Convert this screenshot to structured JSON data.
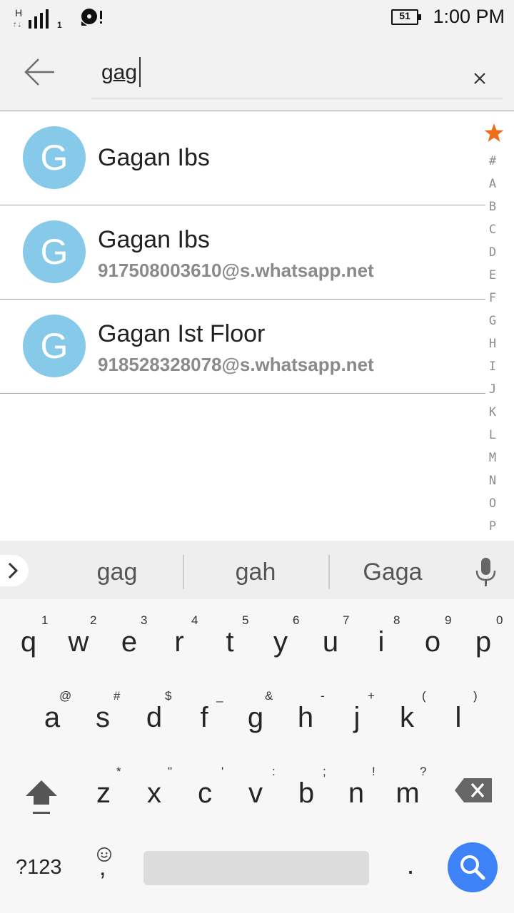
{
  "status_bar": {
    "network_type": "H",
    "sim_slot": "1",
    "battery_level": "51",
    "time": "1:00 PM"
  },
  "search": {
    "query": "gag",
    "back_icon": "arrow-left-icon",
    "clear_icon": "close-icon"
  },
  "contacts": [
    {
      "initial": "G",
      "name": "Gagan Ibs",
      "subtitle": ""
    },
    {
      "initial": "G",
      "name": "Gagan Ibs",
      "subtitle": "917508003610@s.whatsapp.net"
    },
    {
      "initial": "G",
      "name": "Gagan Ist Floor",
      "subtitle": "918528328078@s.whatsapp.net"
    }
  ],
  "index_bar": {
    "star_icon": "star-icon",
    "star_color": "#ef6c1a",
    "letters": [
      "#",
      "A",
      "B",
      "C",
      "D",
      "E",
      "F",
      "G",
      "H",
      "I",
      "J",
      "K",
      "L",
      "M",
      "N",
      "O",
      "P"
    ]
  },
  "keyboard": {
    "suggestions": [
      "gag",
      "gah",
      "Gaga"
    ],
    "row1": [
      {
        "key": "q",
        "alt": "1"
      },
      {
        "key": "w",
        "alt": "2"
      },
      {
        "key": "e",
        "alt": "3"
      },
      {
        "key": "r",
        "alt": "4"
      },
      {
        "key": "t",
        "alt": "5"
      },
      {
        "key": "y",
        "alt": "6"
      },
      {
        "key": "u",
        "alt": "7"
      },
      {
        "key": "i",
        "alt": "8"
      },
      {
        "key": "o",
        "alt": "9"
      },
      {
        "key": "p",
        "alt": "0"
      }
    ],
    "row2": [
      {
        "key": "a",
        "alt": "@"
      },
      {
        "key": "s",
        "alt": "#"
      },
      {
        "key": "d",
        "alt": "$"
      },
      {
        "key": "f",
        "alt": "_"
      },
      {
        "key": "g",
        "alt": "&"
      },
      {
        "key": "h",
        "alt": "-"
      },
      {
        "key": "j",
        "alt": "+"
      },
      {
        "key": "k",
        "alt": "("
      },
      {
        "key": "l",
        "alt": ")"
      }
    ],
    "row3": [
      {
        "key": "z",
        "alt": "*"
      },
      {
        "key": "x",
        "alt": "\""
      },
      {
        "key": "c",
        "alt": "'"
      },
      {
        "key": "v",
        "alt": ":"
      },
      {
        "key": "b",
        "alt": ";"
      },
      {
        "key": "n",
        "alt": "!"
      },
      {
        "key": "m",
        "alt": "?"
      }
    ],
    "symbols_label": "?123",
    "comma_label": ",",
    "period_label": ".",
    "action_color": "#3e82f7"
  }
}
